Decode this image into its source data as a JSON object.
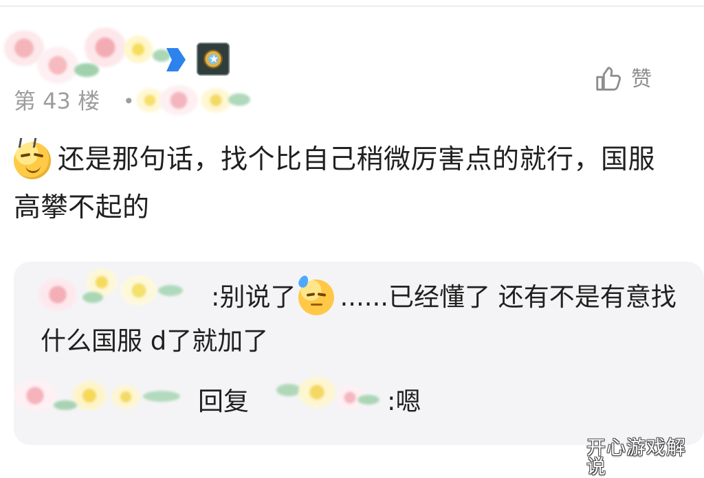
{
  "post": {
    "floor_label": "第 43 楼",
    "separator": "•",
    "like_label": "赞",
    "comment_text": "还是那句话，找个比自己稍微厉害点的就行，国服高攀不起的"
  },
  "reply_thread": {
    "reply_1": {
      "prefix": ":",
      "text_before_emoji": "别说了",
      "text_after_emoji": "......已经懂了 还有不是有意找什么国服 d了就加了"
    },
    "reply_2": {
      "action_label": "回复",
      "text": ":嗯"
    }
  },
  "watermark": {
    "text": "开心游戏解说"
  },
  "colors": {
    "background": "#ffffff",
    "reply_box": "#f4f4f6",
    "text_primary": "#202020",
    "text_secondary": "#9d9d9d",
    "icon_gray": "#8e8e8e",
    "accent_blue": "#2c83ee"
  },
  "icons": {
    "like": "thumbs-up-icon",
    "rank": "rank-badge-icon",
    "emoji_cool": "cool-face-emoji",
    "emoji_sweat": "sweat-face-emoji"
  }
}
